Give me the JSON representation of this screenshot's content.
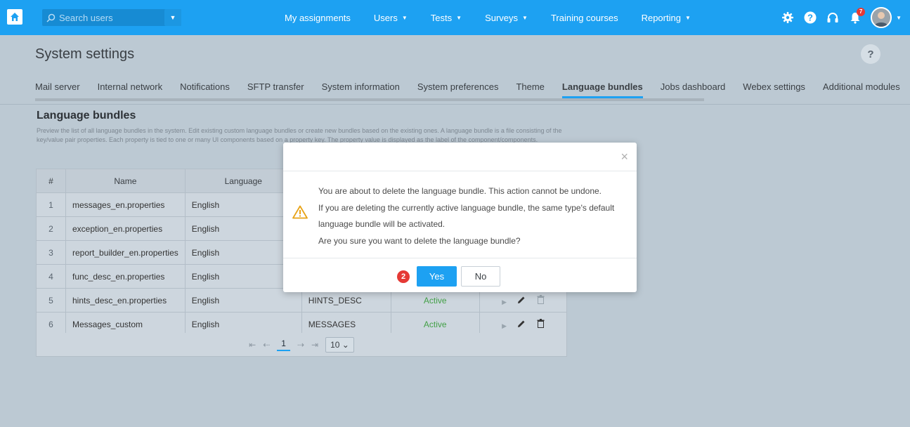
{
  "topbar": {
    "search_placeholder": "Search users",
    "nav": [
      {
        "label": "My assignments",
        "dropdown": false
      },
      {
        "label": "Users",
        "dropdown": true
      },
      {
        "label": "Tests",
        "dropdown": true
      },
      {
        "label": "Surveys",
        "dropdown": true
      },
      {
        "label": "Training courses",
        "dropdown": false
      },
      {
        "label": "Reporting",
        "dropdown": true
      }
    ],
    "notification_count": "7",
    "icons": [
      "home-icon",
      "search-icon",
      "gear-icon",
      "help-icon",
      "headset-icon",
      "bell-icon",
      "avatar"
    ]
  },
  "page": {
    "title": "System settings",
    "help": "?"
  },
  "tabs": [
    {
      "label": "Mail server"
    },
    {
      "label": "Internal network"
    },
    {
      "label": "Notifications"
    },
    {
      "label": "SFTP transfer"
    },
    {
      "label": "System information"
    },
    {
      "label": "System preferences"
    },
    {
      "label": "Theme"
    },
    {
      "label": "Language bundles",
      "active": true
    },
    {
      "label": "Jobs dashboard"
    },
    {
      "label": "Webex settings"
    },
    {
      "label": "Additional modules"
    }
  ],
  "section": {
    "title": "Language bundles",
    "description": "Preview the list of all language bundles in the system. Edit existing custom language bundles or create new bundles based on the existing ones. A language bundle is a file consisting of the key/value pair properties. Each property is tied to one or many UI components based on a property key. The property value is displayed as the label of the component/components."
  },
  "table": {
    "headers": [
      "#",
      "Name",
      "Language",
      "",
      "",
      ""
    ],
    "rows": [
      {
        "num": "1",
        "name": "messages_en.properties",
        "language": "English",
        "type": "",
        "status": ""
      },
      {
        "num": "2",
        "name": "exception_en.properties",
        "language": "English",
        "type": "",
        "status": ""
      },
      {
        "num": "3",
        "name": "report_builder_en.properties",
        "language": "English",
        "type": "",
        "status": ""
      },
      {
        "num": "4",
        "name": "func_desc_en.properties",
        "language": "English",
        "type": "",
        "status": ""
      },
      {
        "num": "5",
        "name": "hints_desc_en.properties",
        "language": "English",
        "type": "HINTS_DESC",
        "status": "Active"
      },
      {
        "num": "6",
        "name": "Messages_custom",
        "language": "English",
        "type": "MESSAGES",
        "status": "Active"
      }
    ],
    "pager": {
      "first": "⇤",
      "prev": "⇠",
      "current_page": "1",
      "next": "⇢",
      "last": "⇥",
      "per_page": "10"
    }
  },
  "modal": {
    "close": "×",
    "lines": [
      "You are about to delete the language bundle. This action cannot be undone.",
      "If you are deleting the currently active language bundle, the same type's default",
      "language bundle will be activated.",
      "Are you sure you want to delete the language bundle?"
    ],
    "step_badge": "2",
    "yes_label": "Yes",
    "no_label": "No"
  },
  "colors": {
    "accent": "#1da1f2",
    "active_status": "#43a047",
    "warning": "#e8a317",
    "badge": "#e53935"
  }
}
